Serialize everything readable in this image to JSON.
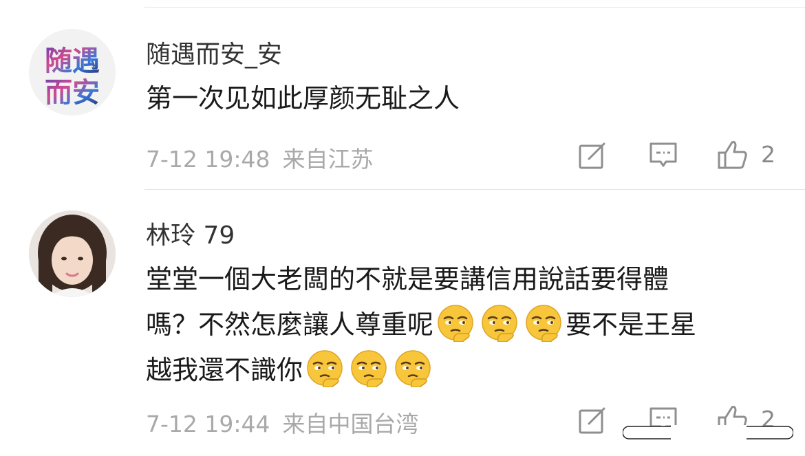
{
  "comments": [
    {
      "avatar_text_top": "随遇",
      "avatar_text_bottom": "而安",
      "username": "随遇而安_安",
      "text": "第一次见如此厚颜无耻之人",
      "timestamp": "7-12 19:48",
      "location": "来自江苏",
      "like_count": "2"
    },
    {
      "username": "林玲 79",
      "text_parts": {
        "line1": "堂堂一個大老闆的不就是要講信用說話要得體",
        "line2a": "嗎？不然怎麼讓人尊重呢",
        "line2b": "要不是王星",
        "line3": "越我還不識你"
      },
      "emoji_name": "thinking-face-emoji",
      "timestamp": "7-12 19:44",
      "location": "来自中国台湾",
      "like_count": "2"
    }
  ],
  "colors": {
    "meta_text": "#a9a9a9",
    "icon": "#8f8f8f",
    "divider": "#e5e5e5"
  },
  "icons": [
    "edit-icon",
    "comment-icon",
    "thumbs-up-icon"
  ]
}
